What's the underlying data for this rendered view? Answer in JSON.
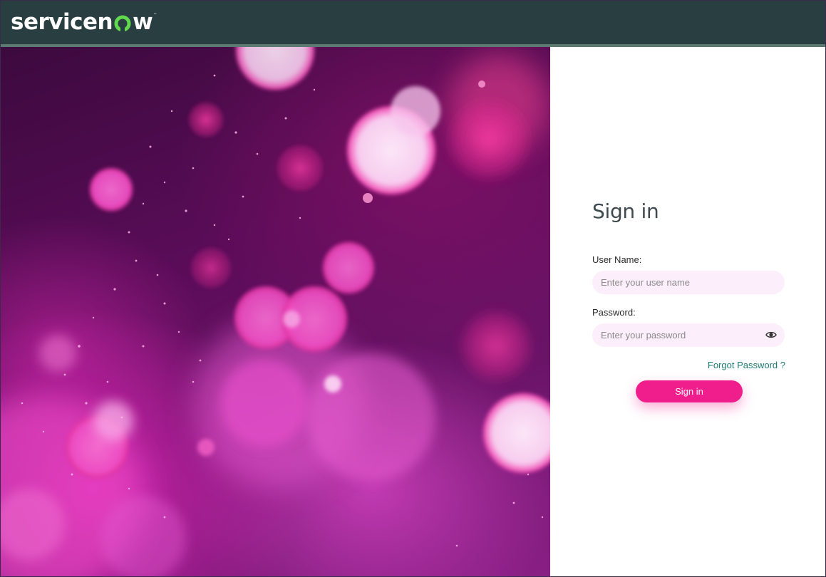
{
  "header": {
    "logo_text_1": "servicen",
    "logo_text_2": "w",
    "logo_tm": "™"
  },
  "signin": {
    "title": "Sign in",
    "username_label": "User Name:",
    "username_placeholder": "Enter your user name",
    "username_value": "",
    "password_label": "Password:",
    "password_placeholder": "Enter your password",
    "password_value": "",
    "forgot_link": "Forgot Password ?",
    "submit_label": "Sign in"
  },
  "icons": {
    "show_password": "eye-icon"
  },
  "colors": {
    "header_bg": "#293e40",
    "header_stripe": "#5c7a72",
    "logo_accent": "#62d84e",
    "button_bg": "#f01e8c",
    "link": "#1e7b6f",
    "input_bg": "#fdeefb"
  }
}
